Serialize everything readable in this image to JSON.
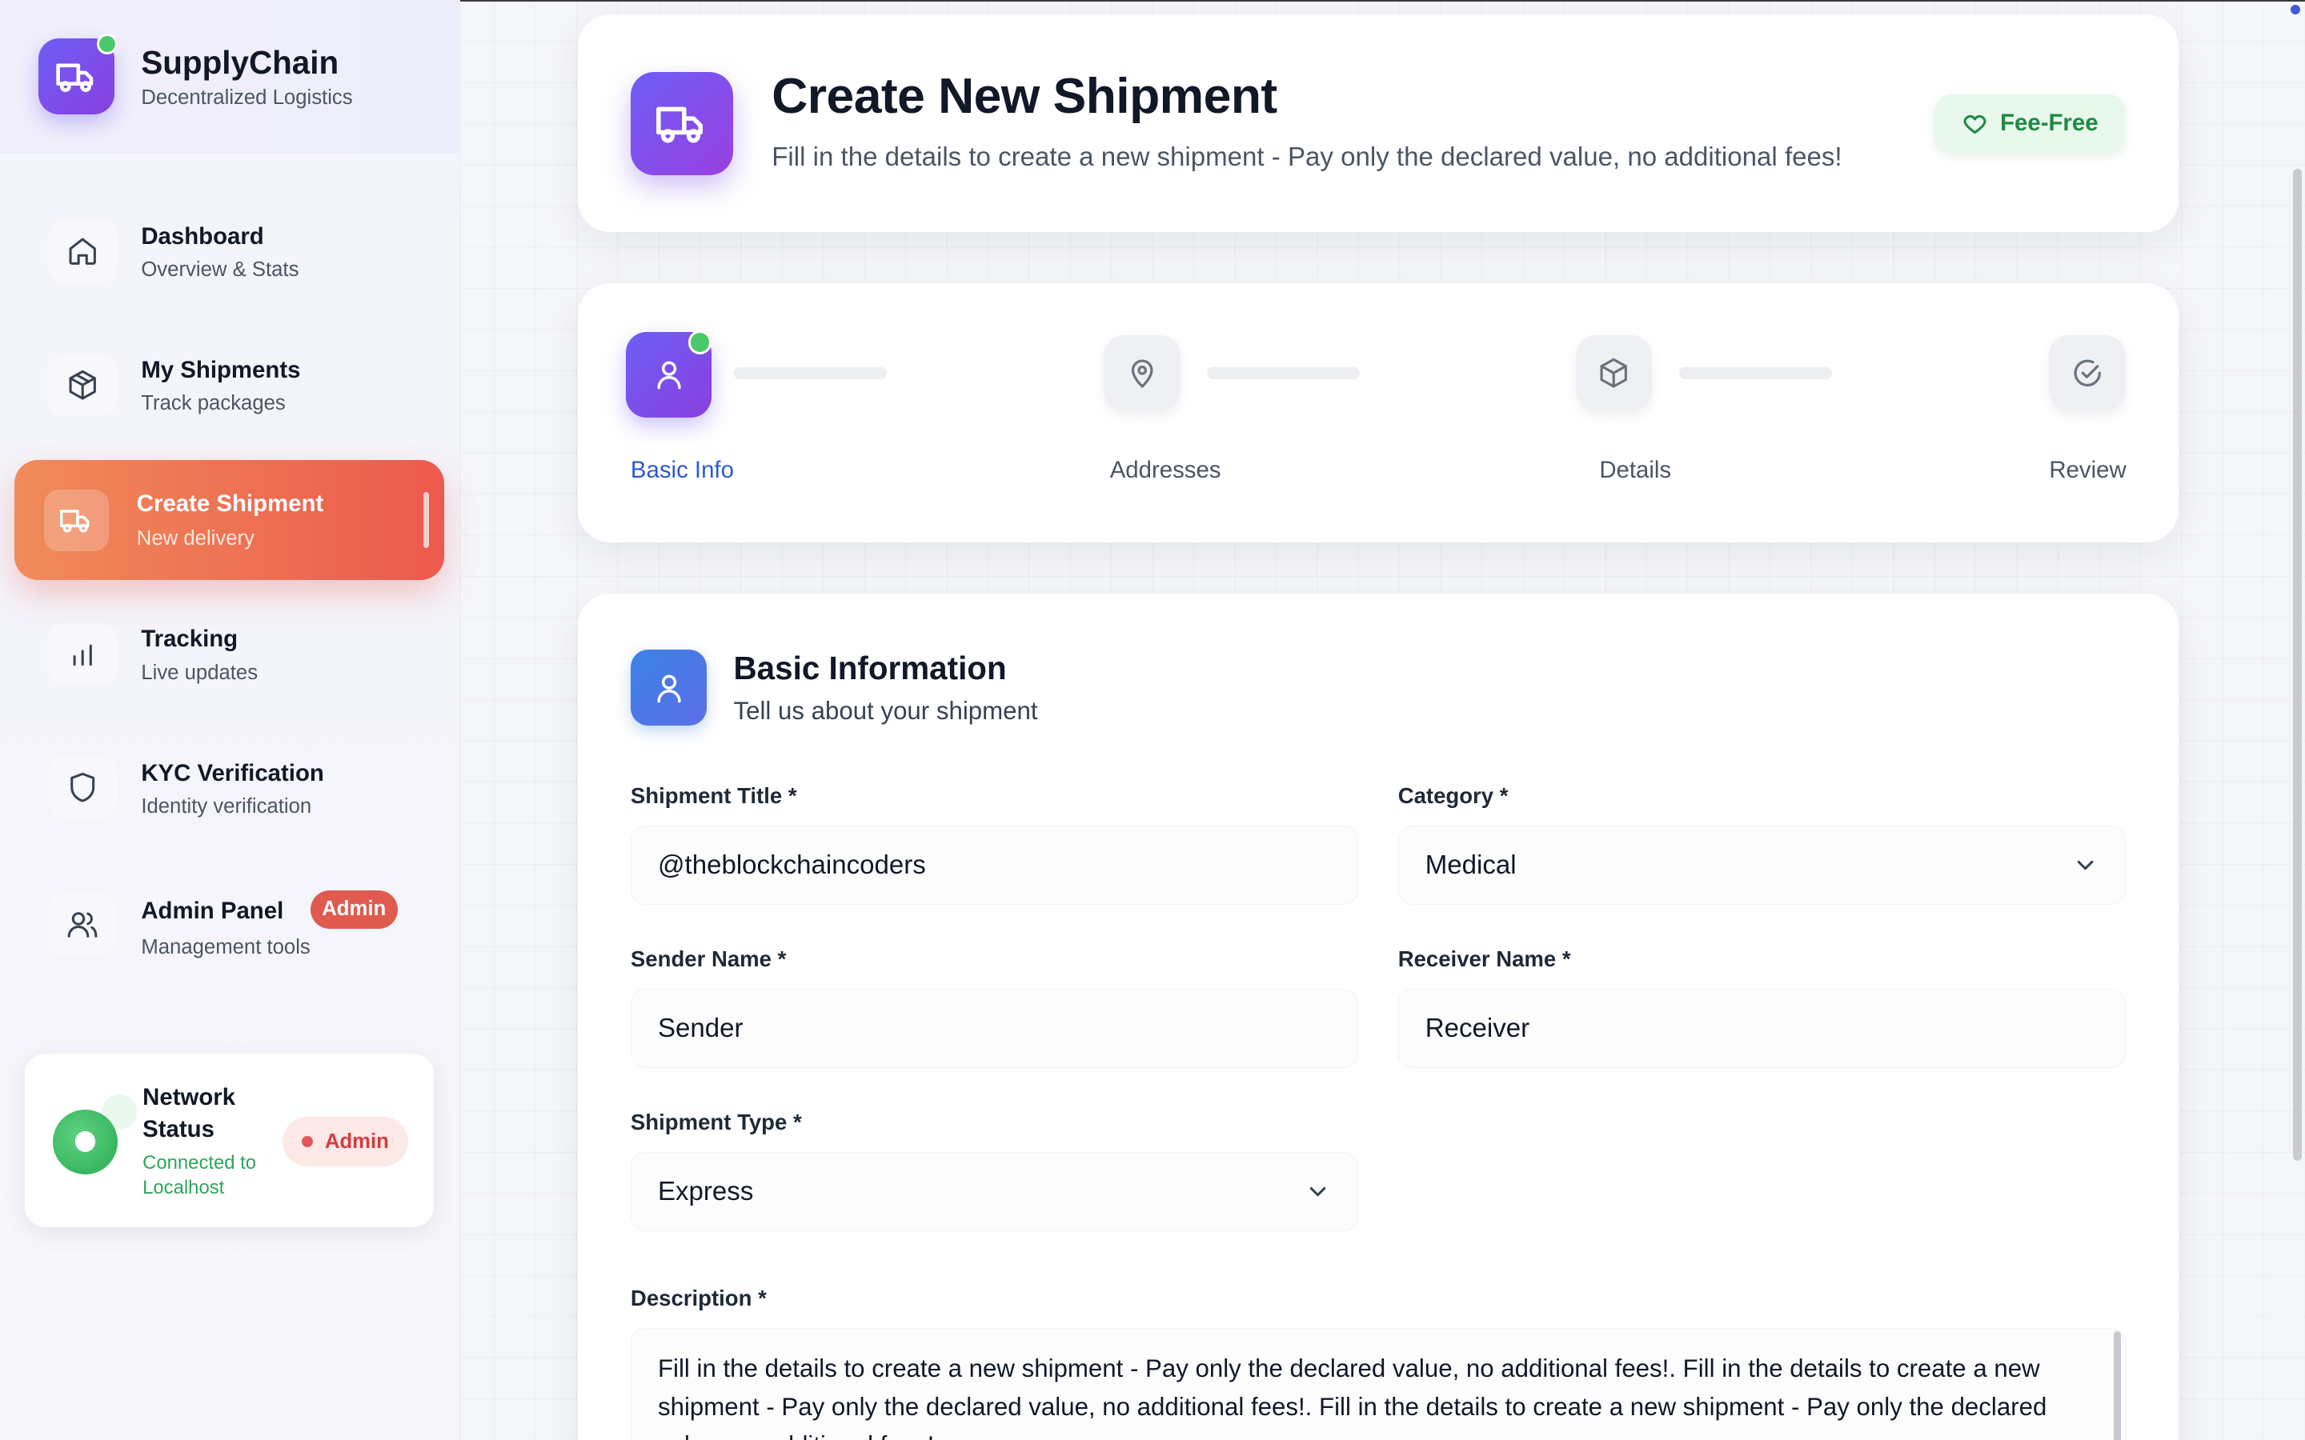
{
  "brand": {
    "title": "SupplyChain",
    "subtitle": "Decentralized Logistics",
    "logo_icon": "truck-icon"
  },
  "nav": [
    {
      "title": "Dashboard",
      "subtitle": "Overview & Stats",
      "icon": "home-icon"
    },
    {
      "title": "My Shipments",
      "subtitle": "Track packages",
      "icon": "package-icon"
    },
    {
      "title": "Create Shipment",
      "subtitle": "New delivery",
      "icon": "truck-icon",
      "active": true
    },
    {
      "title": "Tracking",
      "subtitle": "Live updates",
      "icon": "bar-chart-icon"
    },
    {
      "title": "KYC Verification",
      "subtitle": "Identity verification",
      "icon": "shield-icon"
    },
    {
      "title": "Admin Panel",
      "subtitle": "Management tools",
      "icon": "users-icon",
      "badge": "Admin"
    }
  ],
  "network": {
    "title": "Network Status",
    "status": "Connected to Localhost",
    "badge": "Admin"
  },
  "header": {
    "title": "Create New Shipment",
    "subtitle": "Fill in the details to create a new shipment - Pay only the declared value, no additional fees!",
    "badge": "Fee-Free"
  },
  "steps": [
    {
      "label": "Basic Info",
      "icon": "user-icon",
      "active": true
    },
    {
      "label": "Addresses",
      "icon": "map-pin-icon"
    },
    {
      "label": "Details",
      "icon": "package-icon"
    },
    {
      "label": "Review",
      "icon": "check-circle-icon"
    }
  ],
  "form": {
    "section_title": "Basic Information",
    "section_subtitle": "Tell us about your shipment",
    "shipment_title": {
      "label": "Shipment Title *",
      "value": "@theblockchaincoders"
    },
    "category": {
      "label": "Category *",
      "value": "Medical"
    },
    "sender_name": {
      "label": "Sender Name *",
      "value": "Sender"
    },
    "receiver_name": {
      "label": "Receiver Name *",
      "value": "Receiver"
    },
    "shipment_type": {
      "label": "Shipment Type *",
      "value": "Express"
    },
    "description": {
      "label": "Description *",
      "value": "Fill in the details to create a new shipment - Pay only the declared value, no additional fees!. Fill in the details to create a new shipment - Pay only the declared value, no additional fees!. Fill in the details to create a new shipment - Pay only the declared value, no additional fees!"
    }
  },
  "colors": {
    "accent_purple": "#6d5ef5",
    "active_nav_gradient_start": "#f08b5a",
    "active_nav_gradient_end": "#ec5a4e",
    "success_green": "#4cc86c",
    "admin_red": "#e05a4f",
    "step_active_label": "#2c5bd0"
  }
}
